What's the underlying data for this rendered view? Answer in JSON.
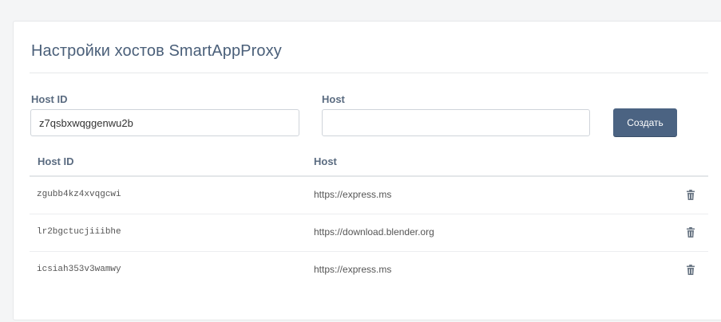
{
  "page": {
    "title": "Настройки хостов SmartAppProxy"
  },
  "form": {
    "host_id_label": "Host ID",
    "host_id_value": "z7qsbxwqggenwu2b",
    "host_label": "Host",
    "host_value": "",
    "create_button_label": "Создать"
  },
  "table": {
    "columns": [
      "Host ID",
      "Host"
    ],
    "rows": [
      {
        "host_id": "zgubb4kz4xvqgcwi",
        "host": "https://express.ms"
      },
      {
        "host_id": "lr2bgctucjiiibhe",
        "host": "https://download.blender.org"
      },
      {
        "host_id": "icsiah353v3wamwy",
        "host": "https://express.ms"
      }
    ]
  },
  "icons": {
    "delete": "trash-icon"
  },
  "colors": {
    "accent": "#4b6382",
    "title": "#4a5f79",
    "label": "#5a6b80"
  }
}
